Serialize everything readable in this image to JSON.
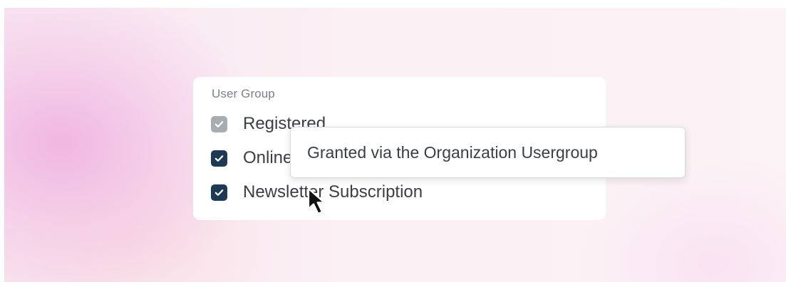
{
  "user_group": {
    "title": "User Group",
    "options": [
      {
        "label": "Registered",
        "state": "checked-disabled"
      },
      {
        "label": "Online Shop Customer",
        "state": "checked"
      },
      {
        "label": "Newsletter Subscription",
        "state": "checked"
      }
    ]
  },
  "tooltip": {
    "text": "Granted via the Organization Usergroup"
  },
  "colors": {
    "checkbox_checked": "#1e3a52",
    "checkbox_disabled": "#a8adb2"
  },
  "icons": {
    "check": "check-icon",
    "cursor": "mouse-pointer-icon"
  }
}
